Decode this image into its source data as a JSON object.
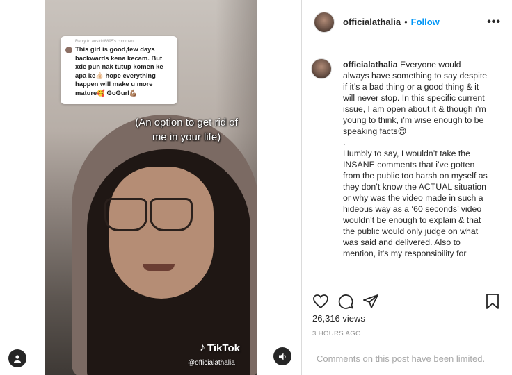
{
  "video": {
    "comment_reply": "Reply to ansfrid8895's comment",
    "comment_text": "This girl is good,few days backwards kena kecam. But xde pun nak tutup komen ke apa ke👍🏻 hope everything happen will make u more mature🥰 GoGurl💪🏽",
    "caption_overlay": "(An option to get rid of me in your life)",
    "tiktok_label": "TikTok",
    "tiktok_user": "@officialathalia"
  },
  "header": {
    "username": "officialathalia",
    "separator": "•",
    "follow_label": "Follow",
    "more_label": "•••"
  },
  "caption": {
    "username": "officialathalia",
    "p1": "Everyone would always have something to say despite if it’s a bad thing or a good thing & it will never stop. In this specific current issue, I am open about it & though i’m young to think, i’m wise enough to be speaking facts😊",
    "p2": ".",
    "p3": "Humbly to say, I wouldn’t take the INSANE comments that i’ve gotten from the public too harsh on myself as they don’t know the ACTUAL situation or why was the video made in such a hideous way as a ‘60 seconds’ video wouldn’t be enough to explain & that the public would only judge on what was said and delivered. Also to mention, it’s my responsibility for"
  },
  "stats": {
    "views": "26,316 views",
    "time": "3 HOURS AGO"
  },
  "comments": {
    "limited": "Comments on this post have been limited."
  },
  "icons": [
    "heart-icon",
    "comment-icon",
    "share-icon",
    "bookmark-icon",
    "user-tag-icon",
    "sound-icon",
    "more-icon"
  ],
  "colors": {
    "link": "#0095f6",
    "muted": "#8e8e8e",
    "text": "#262626"
  }
}
